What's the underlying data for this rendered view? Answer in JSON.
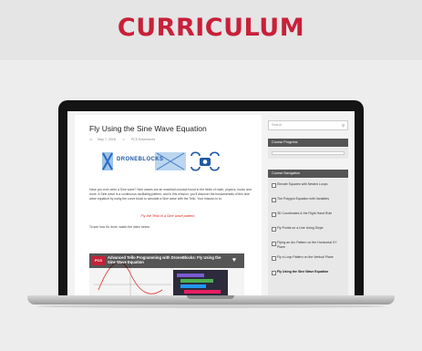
{
  "header": {
    "title": "CURRICULUM"
  },
  "page": {
    "title": "Fly Using the Sine Wave Equation",
    "date": "May 7, 2018",
    "author": "PCS Edventures",
    "logo_text": "DRONEBLOCKS",
    "intro": "Have you ever seen a Sine wave? Sine waves are an essential concept found in the fields of math, physics, music and more. A Sine wave is a continuous oscillating pattern, and in this mission, you'll discover the fundamentals of this sine wave equation by using the curve block to simulate a Sine wave with the Tello. Your mission is to:",
    "mission": "Fly the Tello in a Sine wave pattern.",
    "see_how": "To see how it's done, watch the video below:",
    "video": {
      "badge": "PCS",
      "title": "Advanced Tello Programming with DroneBlocks: Fly Using the Sine Wave Equation"
    }
  },
  "sidebar": {
    "search_placeholder": "Search",
    "progress_heading": "Course Progress",
    "nav_heading": "Course Navigation",
    "nav_items": [
      "Elevate Squares with Nested Loops",
      "The Polygon Equation with Variables",
      "3D Coordinates & the Right Hand Rule",
      "Fly Points on a Line Using Slope",
      "Flying an Arc Pattern on the Horizontal XY Plane",
      "Fly a Loop Pattern on the Vertical Plane",
      "Fly Using the Sine Wave Equation"
    ],
    "current_index": 6
  },
  "colors": {
    "brand": "#c8203a",
    "mission_text": "#e02020"
  },
  "icons": {
    "search": "search-icon",
    "heart": "heart-icon",
    "calendar": "calendar-icon",
    "user": "user-icon"
  }
}
